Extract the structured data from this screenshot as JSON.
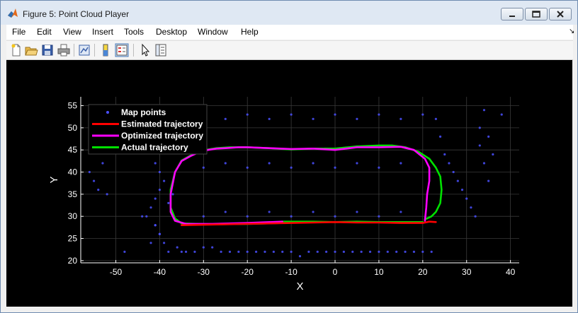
{
  "window": {
    "title": "Figure 5: Point Cloud Player"
  },
  "menu": [
    "File",
    "Edit",
    "View",
    "Insert",
    "Tools",
    "Desktop",
    "Window",
    "Help"
  ],
  "menu_dock_glyph": "↘",
  "toolbar": [
    "new-figure",
    "open-file",
    "save",
    "print",
    "link-plot",
    "colorbar",
    "legend",
    "edit-plot",
    "property-inspector"
  ],
  "colors": {
    "map_points": "#4a50ff",
    "estimated": "#ff0000",
    "optimized": "#ff00ff",
    "actual": "#00e000",
    "figure_bg": "#000000",
    "axes_text": "#ffffff"
  },
  "chart_data": {
    "type": "scatter",
    "title": "",
    "xlabel": "X",
    "ylabel": "Y",
    "xlim": [
      -58,
      42
    ],
    "ylim": [
      19.5,
      57
    ],
    "xticks": [
      -50,
      -40,
      -30,
      -20,
      -10,
      0,
      10,
      20,
      30,
      40
    ],
    "yticks": [
      20,
      25,
      30,
      35,
      40,
      45,
      50,
      55
    ],
    "grid": true,
    "legend_position": "top-left",
    "series": [
      {
        "name": "Map points",
        "kind": "scatter",
        "x": [
          -56,
          -55,
          -54,
          -53,
          -52,
          -48,
          -44,
          -41,
          -40,
          -39,
          -38,
          -38,
          -37,
          -36,
          -35,
          -34,
          -32,
          -30,
          -28,
          -26,
          -24,
          -22,
          -20,
          -18,
          -16,
          -14,
          -12,
          -10,
          -8,
          -6,
          -4,
          -2,
          0,
          2,
          4,
          6,
          8,
          10,
          12,
          14,
          16,
          18,
          20,
          22,
          23,
          24,
          25,
          26,
          27,
          28,
          29,
          30,
          31,
          32,
          33,
          33,
          34,
          34,
          35,
          35,
          36,
          38,
          -30,
          -25,
          -20,
          -15,
          -10,
          -5,
          0,
          5,
          10,
          15,
          -30,
          -25,
          -20,
          -15,
          -10,
          -5,
          0,
          5,
          10,
          15,
          -25,
          -20,
          -15,
          -10,
          -5,
          0,
          5,
          10,
          15,
          20,
          -43,
          -42,
          -41,
          -40,
          -39,
          -41,
          -40,
          -42,
          -40,
          -41
        ],
        "y": [
          40,
          38,
          36,
          42,
          35,
          22,
          30,
          28,
          26,
          24,
          22,
          33,
          35,
          23,
          22,
          22,
          22,
          23,
          23,
          22,
          22,
          22,
          22,
          22,
          22,
          22,
          22,
          22,
          21,
          22,
          22,
          22,
          22,
          22,
          22,
          22,
          22,
          22,
          22,
          22,
          22,
          22,
          22,
          22,
          52,
          48,
          44,
          42,
          40,
          38,
          36,
          34,
          32,
          30,
          50,
          46,
          54,
          42,
          48,
          38,
          44,
          53,
          30,
          31,
          30,
          31,
          30,
          31,
          30,
          31,
          30,
          31,
          41,
          42,
          41,
          42,
          41,
          42,
          41,
          42,
          41,
          42,
          52,
          53,
          52,
          53,
          52,
          53,
          52,
          53,
          52,
          53,
          30,
          32,
          34,
          36,
          38,
          28,
          26,
          24,
          40,
          42
        ]
      },
      {
        "name": "Estimated trajectory",
        "kind": "line",
        "x": [
          -35,
          -25,
          -15,
          -10,
          -5,
          0,
          5,
          10,
          15,
          20,
          21.5,
          23
        ],
        "y": [
          28,
          28.2,
          28.4,
          28.5,
          28.6,
          28.7,
          28.6,
          28.6,
          28.5,
          28.5,
          28.8,
          28.7
        ]
      },
      {
        "name": "Optimized trajectory",
        "kind": "line",
        "x": [
          -12,
          -20,
          -28,
          -34,
          -36.5,
          -37.5,
          -37.5,
          -36.5,
          -35,
          -33,
          -31,
          -29,
          -27,
          -25,
          -22,
          -20,
          -15,
          -10,
          -5,
          0,
          5,
          10,
          15,
          18,
          20.5,
          21.5,
          21.5,
          21,
          20.8,
          20.5
        ],
        "y": [
          28.8,
          28.5,
          28.3,
          28.3,
          29,
          31,
          35,
          40,
          42.5,
          43.6,
          44.5,
          45,
          45.3,
          45.4,
          45.6,
          45.6,
          45.4,
          45.2,
          45.3,
          45,
          45.6,
          45.6,
          45.7,
          45,
          43,
          41,
          38,
          35,
          32,
          29
        ]
      },
      {
        "name": "Actual trajectory",
        "kind": "line",
        "x": [
          20,
          15,
          10,
          5,
          0,
          -5,
          -10,
          -12,
          -12,
          -20,
          -28,
          -35,
          -36.5,
          -37.5,
          -37.5,
          -36.5,
          -35,
          -33,
          -31,
          -29,
          -27,
          -24,
          -20,
          -15,
          -10,
          -5,
          0,
          5,
          10,
          13,
          16,
          19,
          21.5,
          23,
          24,
          24.3,
          24,
          23,
          22,
          20.5
        ],
        "y": [
          28.7,
          28.7,
          28.7,
          28.8,
          28.7,
          28.8,
          28.8,
          28.8,
          28.5,
          28.3,
          28.2,
          28.4,
          29.5,
          32,
          36,
          40,
          42.6,
          43.7,
          44.6,
          45.1,
          45.4,
          45.6,
          45.6,
          45.4,
          45.1,
          45.3,
          45.3,
          45.8,
          46,
          46,
          45.6,
          44.6,
          43,
          41,
          39,
          36,
          33,
          31,
          30,
          29.3
        ]
      }
    ]
  }
}
